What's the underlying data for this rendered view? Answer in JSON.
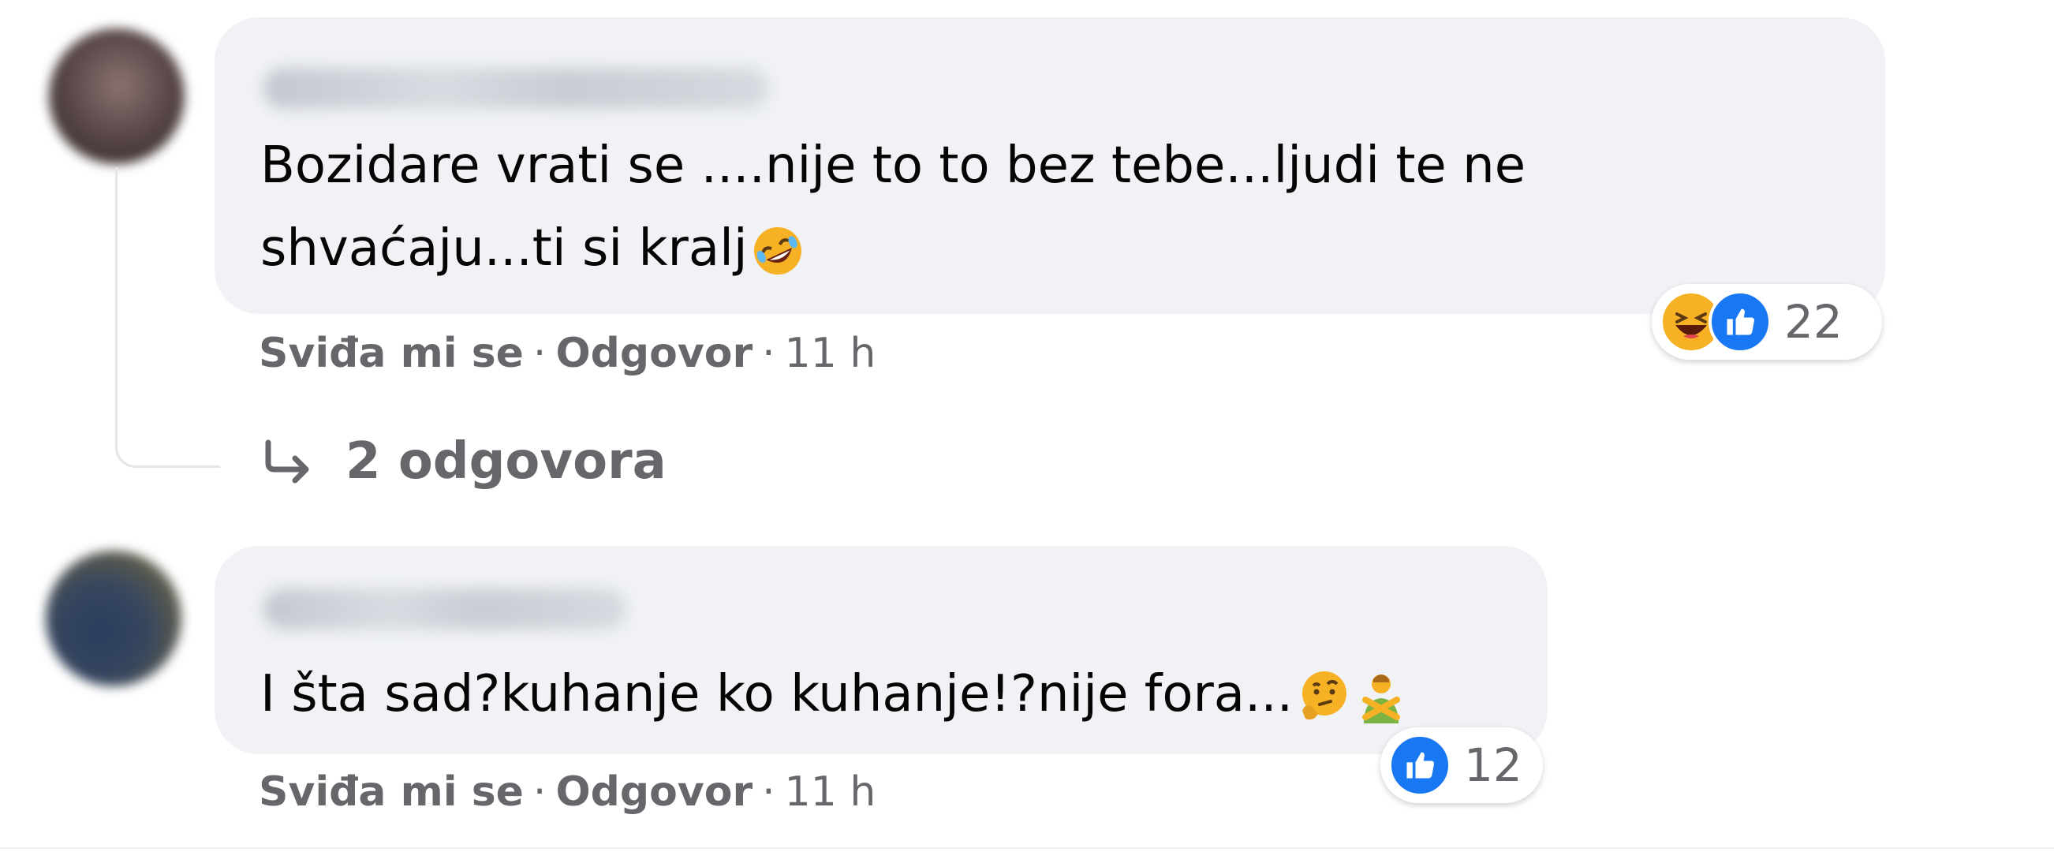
{
  "comments": [
    {
      "text": "Bozidare vrati se ....nije to to bez tebe...ljudi te ne shvaćaju...ti si kralj",
      "emoji_icons": [
        "rofl-emoji-icon"
      ],
      "reactions": {
        "icons": [
          "haha-reaction-icon",
          "like-reaction-icon"
        ],
        "count": "22"
      },
      "actions": {
        "like": "Sviđa mi se",
        "separator": "·",
        "reply": "Odgovor",
        "time": "11 h"
      },
      "replies_link": "2 odgovora"
    },
    {
      "text": "I šta sad?kuhanje ko kuhanje!?nije fora...",
      "emoji_icons": [
        "thinking-face-emoji-icon",
        "person-gesturing-no-emoji-icon"
      ],
      "reactions": {
        "icons": [
          "like-reaction-icon"
        ],
        "count": "12"
      },
      "actions": {
        "like": "Sviđa mi se",
        "separator": "·",
        "reply": "Odgovor",
        "time": "11 h"
      }
    }
  ],
  "colors": {
    "bubble": "#f0f2f5",
    "text": "#050505",
    "secondary_text": "#65676b",
    "like_blue": "#1877f2",
    "haha_yellow": "#f7b125"
  }
}
